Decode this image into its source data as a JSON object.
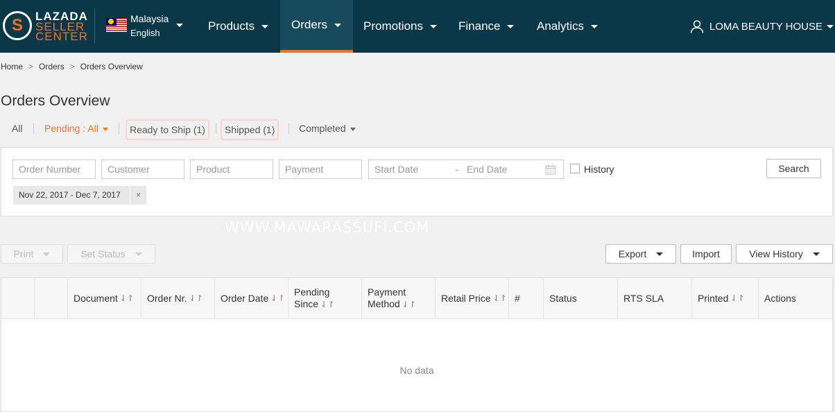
{
  "header": {
    "logo": {
      "line1": "LAZADA",
      "line2": "SELLER",
      "line3": "CENTER"
    },
    "country": "Malaysia",
    "language": "English",
    "nav": [
      {
        "label": "Products"
      },
      {
        "label": "Orders"
      },
      {
        "label": "Promotions"
      },
      {
        "label": "Finance"
      },
      {
        "label": "Analytics"
      }
    ],
    "active_nav": "Orders",
    "user": "LOMA BEAUTY HOUSE"
  },
  "breadcrumb": [
    "Home",
    "Orders",
    "Orders Overview"
  ],
  "page_title": "Orders Overview",
  "tabs": {
    "all": "All",
    "pending_label": "Pending : ",
    "pending_value": "All",
    "ready_to_ship": "Ready to Ship (1)",
    "shipped": "Shipped (1)",
    "completed": "Completed"
  },
  "filters": {
    "order_number_placeholder": "Order Number",
    "customer_placeholder": "Customer",
    "product_placeholder": "Product",
    "payment_placeholder": "Payment",
    "start_date_placeholder": "Start Date",
    "date_separator": "-",
    "end_date_placeholder": "End Date",
    "history_label": "History",
    "search_label": "Search",
    "active_date_chip": "Nov 22, 2017 - Dec 7, 2017",
    "chip_close": "×"
  },
  "watermark": "WWW.MAWARASSUFI.COM",
  "actions": {
    "print": "Print",
    "set_status": "Set Status",
    "export": "Export",
    "import": "Import",
    "view_history": "View History"
  },
  "table": {
    "columns": {
      "document": "Document",
      "order_nr": "Order Nr.",
      "order_date": "Order Date",
      "pending_since_1": "Pending",
      "pending_since_2": "Since",
      "payment_method_1": "Payment",
      "payment_method_2": "Method",
      "retail_price": "Retail Price",
      "hash": "#",
      "status": "Status",
      "rts_sla": "RTS SLA",
      "printed": "Printed",
      "actions": "Actions"
    },
    "empty_text": "No data"
  },
  "colors": {
    "header_bg": "#0b3848",
    "accent": "#f57224"
  }
}
